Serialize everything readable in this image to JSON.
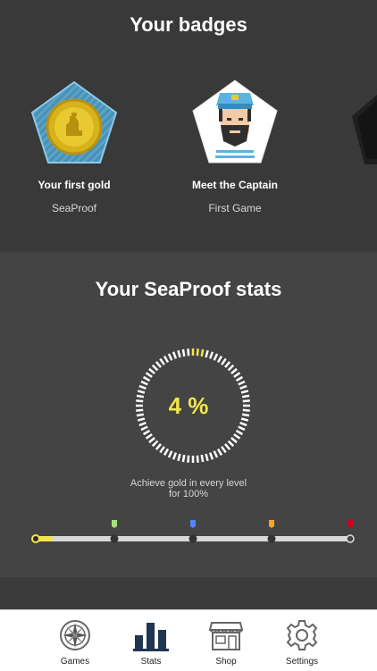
{
  "badges_section": {
    "title": "Your badges",
    "badges": [
      {
        "title": "Your first gold",
        "subtitle": "SeaProof",
        "icon": "gold-coin-badge-icon"
      },
      {
        "title": "Meet the Captain",
        "subtitle": "First Game",
        "icon": "captain-badge-icon"
      }
    ]
  },
  "stats_section": {
    "title": "Your SeaProof stats",
    "progress_text": "4 %",
    "progress_percent": 4,
    "hint_line1": "Achieve gold in every level",
    "hint_line2": "for 100%",
    "milestone_colors": [
      "#a6e07a",
      "#4f86ff",
      "#f5a623",
      "#d0021b"
    ],
    "accent_color": "#f2e64a"
  },
  "tabbar": {
    "tabs": [
      {
        "label": "Games",
        "icon": "compass-icon"
      },
      {
        "label": "Stats",
        "icon": "bar-chart-icon"
      },
      {
        "label": "Shop",
        "icon": "shop-icon"
      },
      {
        "label": "Settings",
        "icon": "gear-icon"
      }
    ],
    "active_index": 1
  }
}
